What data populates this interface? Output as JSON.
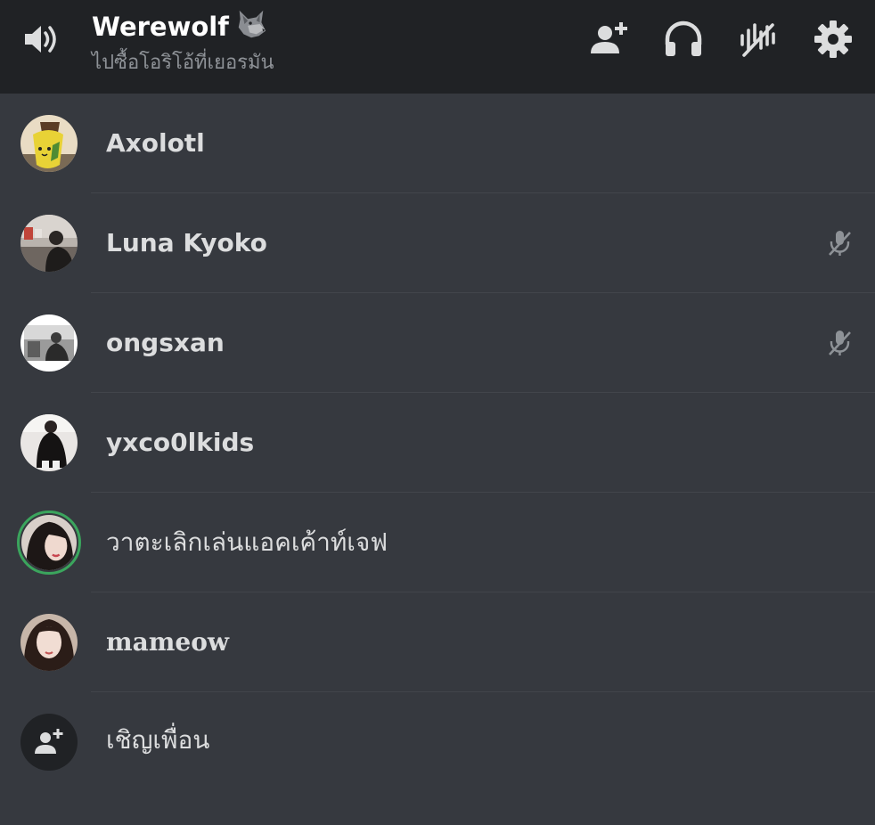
{
  "header": {
    "channel_name": "Werewolf",
    "channel_emoji": "wolf-emoji",
    "status_text": "ไปซื้อโอริโอ้ที่เยอรมัน",
    "icons": [
      "speaker-icon",
      "add-user-icon",
      "headset-icon",
      "noise-suppression-icon",
      "gear-icon"
    ]
  },
  "members": [
    {
      "name": "Axolotl",
      "muted": false,
      "speaking": false
    },
    {
      "name": "Luna Kyoko",
      "muted": true,
      "speaking": false
    },
    {
      "name": "ongsxan",
      "muted": true,
      "speaking": false
    },
    {
      "name": "yxco0lkids",
      "muted": false,
      "speaking": false
    },
    {
      "name": "วาตะเลิกเล่นแอคเค้าท์เจฟ",
      "muted": false,
      "speaking": true
    },
    {
      "name": "mameow",
      "muted": false,
      "speaking": false
    }
  ],
  "invite": {
    "label": "เชิญเพื่อน"
  },
  "colors": {
    "background": "#36393f",
    "header": "#202225",
    "speaking_ring": "#3ba55d",
    "muted_icon": "#8e9297"
  }
}
